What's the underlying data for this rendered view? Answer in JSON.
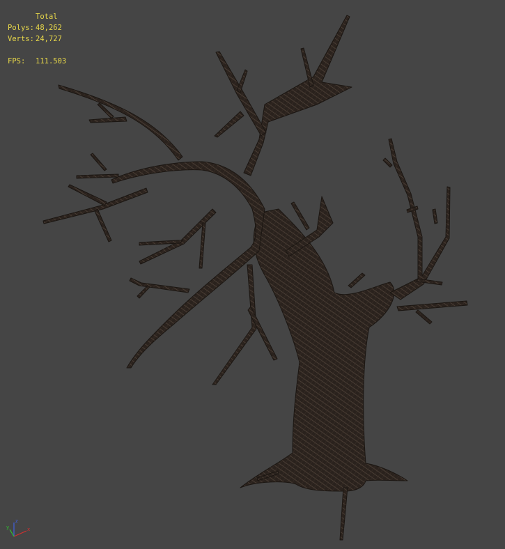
{
  "viewport": {
    "background": "#454545",
    "stats": {
      "header": "Total",
      "polys_label": "Polys:",
      "polys_value": "48,262",
      "verts_label": "Verts:",
      "verts_value": "24,727",
      "fps_label": "FPS:",
      "fps_value": "111.503",
      "text_color": "#e8d84a"
    },
    "axis_gizmo": {
      "x_label": "x",
      "y_label": "y",
      "z_label": "z",
      "x_color": "#d03030",
      "y_color": "#30c030",
      "z_color": "#4060e0"
    },
    "model": {
      "icon": "dead-tree-mesh",
      "fill_color": "#2a221d",
      "wire_color": "#6b5a4c"
    }
  }
}
